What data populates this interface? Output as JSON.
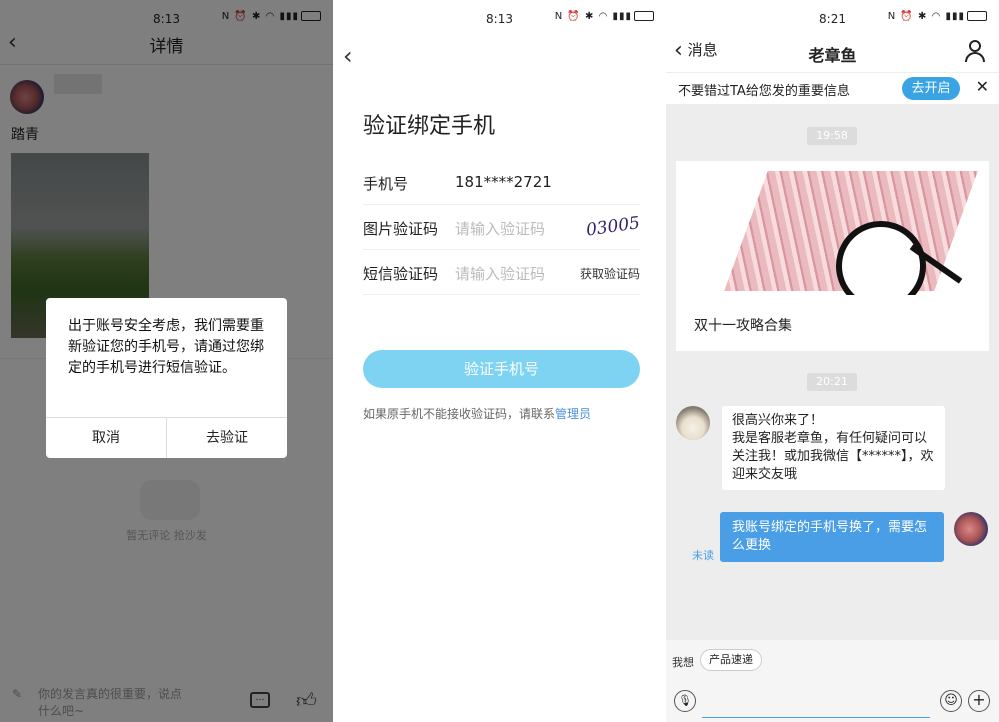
{
  "panel1": {
    "time": "8:13",
    "title": "详情",
    "post_text": "踏青",
    "dialog_message": "出于账号安全考虑，我们需要重新验证您的手机号，请通过您绑定的手机号进行短信验证。",
    "cancel": "取消",
    "verify": "去验证",
    "empty_comments": "暂无评论 抢沙发",
    "comment_placeholder": "你的发言真的很重要，说点什么吧~"
  },
  "panel2": {
    "time": "8:13",
    "title": "验证绑定手机",
    "phone_label": "手机号",
    "phone_value": "181****2721",
    "captcha_label": "图片验证码",
    "captcha_placeholder": "请输入验证码",
    "captcha_image_text": "03005",
    "sms_label": "短信验证码",
    "sms_placeholder": "请输入验证码",
    "get_code": "获取验证码",
    "submit": "验证手机号",
    "footer_text": "如果原手机不能接收验证码，请联系",
    "footer_link": "管理员",
    "link_color": "#4a90d9",
    "button_color": "#7fd3f2"
  },
  "panel3": {
    "time": "8:21",
    "back": "消息",
    "title": "老章鱼",
    "notice": "不要错过TA给您发的重要信息",
    "enable": "去开启",
    "ts1": "19:58",
    "card_title": "双十一攻略合集",
    "ts2": "20:21",
    "msg_in": "很高兴你来了！\n我是客服老章鱼，有任何疑问可以关注我！或加我微信【******】，欢迎来交友哦",
    "unread": "未读",
    "msg_out": "我账号绑定的手机号换了，需要怎么更换",
    "want_label": "我想",
    "chip": "产品速递",
    "accent": "#3aa3e3",
    "out_bubble": "#4a9ee6"
  }
}
